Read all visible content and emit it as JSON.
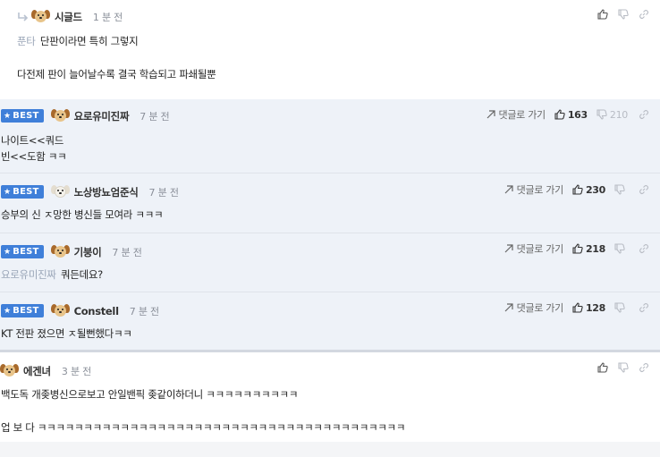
{
  "comments": [
    {
      "author": "시글드",
      "time": "1 분 전",
      "mention": "푼타",
      "lines": [
        "단판이라면 특히 그렇지",
        "",
        "다전제 판이 늘어날수록 결국 학습되고 파쇄될뿐"
      ],
      "avatar": "dog-brown-icon"
    },
    {
      "best": "BEST",
      "author": "요로유미진짜",
      "time": "7 분 전",
      "reply": "댓글로 가기",
      "up": "163",
      "down": "210",
      "lines": [
        "나이트<<쿼드",
        "빈<<도함 ㅋㅋ"
      ],
      "avatar": "dog-brown-icon"
    },
    {
      "best": "BEST",
      "author": "노상방뇨엄준식",
      "time": "7 분 전",
      "reply": "댓글로 가기",
      "up": "230",
      "lines": [
        "승부의 신 ㅈ망한 병신들 모여라 ㅋㅋㅋ"
      ],
      "avatar": "dog-white-icon"
    },
    {
      "best": "BEST",
      "author": "기붕이",
      "time": "7 분 전",
      "reply": "댓글로 가기",
      "up": "218",
      "mention": "요로유미진짜",
      "lines": [
        "쿼든데요?"
      ],
      "avatar": "dog-brown-icon"
    },
    {
      "best": "BEST",
      "author": "Constell",
      "time": "7 분 전",
      "reply": "댓글로 가기",
      "up": "128",
      "lines": [
        "KT 전판 졌으면 ㅈ될뻔했다ㅋㅋ"
      ],
      "avatar": "dog-brown-icon"
    },
    {
      "author": "에겐녀",
      "time": "3 분 전",
      "lines": [
        "백도독 개좆병신으로보고 안일밴픽 좆같이하더니 ㅋㅋㅋㅋㅋㅋㅋㅋㅋㅋ",
        "",
        "업 보 다 ㅋㅋㅋㅋㅋㅋㅋㅋㅋㅋㅋㅋㅋㅋㅋㅋㅋㅋㅋㅋㅋㅋㅋㅋㅋㅋㅋㅋㅋㅋㅋㅋㅋㅋㅋㅋㅋㅋㅋㅋ"
      ],
      "avatar": "dog-brown-icon"
    }
  ],
  "icons": {
    "reply_indent": "reply-arrow-icon",
    "upvote": "thumbs-up-icon",
    "downvote": "thumbs-down-icon",
    "share": "link-icon",
    "goto": "send-arrow-icon"
  },
  "colors": {
    "best_badge": "#3f7fd9",
    "best_row_bg": "#eef2f8",
    "mention": "#9aa6b8",
    "time": "#8a8f99"
  }
}
